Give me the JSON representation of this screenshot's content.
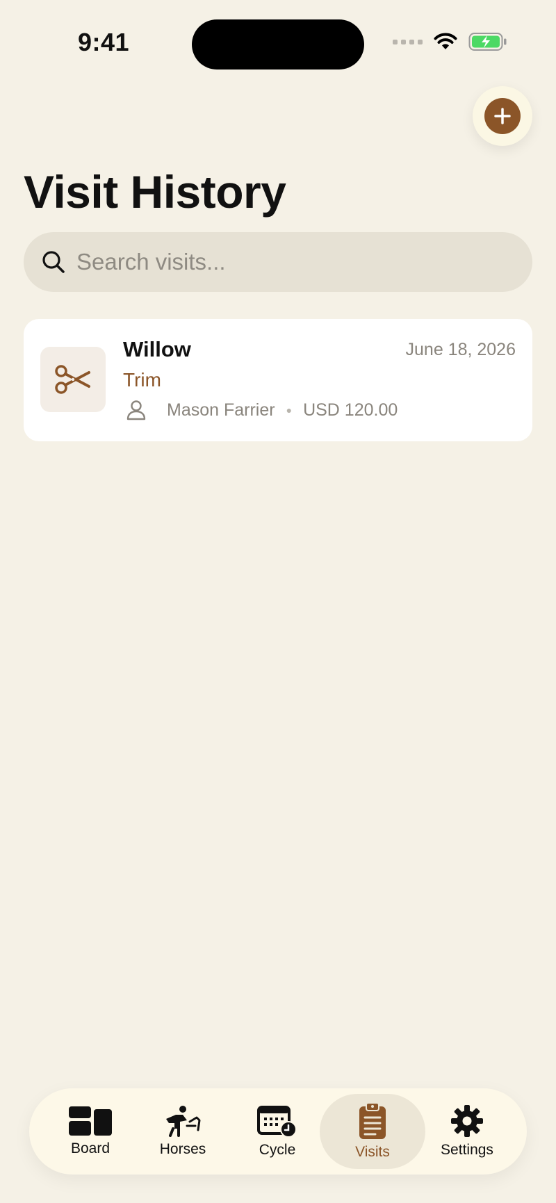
{
  "status_bar": {
    "time": "9:41"
  },
  "header": {
    "title": "Visit History",
    "add_button_label": "+"
  },
  "search": {
    "placeholder": "Search visits..."
  },
  "visits": [
    {
      "horse": "Willow",
      "date": "June 18, 2026",
      "type": "Trim",
      "farrier": "Mason Farrier",
      "cost": "USD 120.00",
      "icon": "scissors-icon"
    }
  ],
  "tab_bar": {
    "items": [
      {
        "label": "Board",
        "icon": "board-icon"
      },
      {
        "label": "Horses",
        "icon": "horse-icon"
      },
      {
        "label": "Cycle",
        "icon": "calendar-clock-icon"
      },
      {
        "label": "Visits",
        "icon": "clipboard-icon",
        "active": true
      },
      {
        "label": "Settings",
        "icon": "gear-icon"
      }
    ]
  },
  "colors": {
    "background": "#f5f1e6",
    "accent": "#8b5528",
    "card": "#ffffff",
    "search_bg": "#e6e1d4",
    "battery": "#4cd964"
  }
}
